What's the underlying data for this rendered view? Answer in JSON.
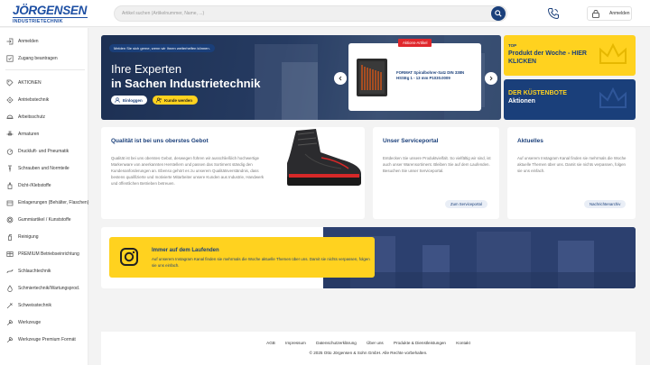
{
  "header": {
    "logo_name": "JÖRGENSEN",
    "logo_sub": "INDUSTRIETECHNIK",
    "search_placeholder": "Artikel suchen (Artikelnummer, Name, ...)",
    "login_label": "Anmelden"
  },
  "sidebar": {
    "items": [
      {
        "label": "Anmelden",
        "icon": "login-icon"
      },
      {
        "label": "Zugang beantragen",
        "icon": "request-access-icon"
      },
      {
        "label": "AKTIONEN",
        "icon": "promotions-icon"
      },
      {
        "label": "Antriebstechnik",
        "icon": "drive-technology-icon"
      },
      {
        "label": "Arbeitsschutz",
        "icon": "safety-icon"
      },
      {
        "label": "Armaturen",
        "icon": "fittings-icon"
      },
      {
        "label": "Druckluft- und Pneumatik",
        "icon": "pneumatics-icon"
      },
      {
        "label": "Schrauben und Normteile",
        "icon": "screws-icon"
      },
      {
        "label": "Dicht-/Klebstoffe",
        "icon": "sealant-icon"
      },
      {
        "label": "Einlagerungen (Behälter, Flaschen)",
        "icon": "storage-icon"
      },
      {
        "label": "Gummiartikel / Kunststoffe",
        "icon": "rubber-icon"
      },
      {
        "label": "Reinigung",
        "icon": "cleaning-icon"
      },
      {
        "label": "PREMIUM Betriebseinrichtung",
        "icon": "premium-icon"
      },
      {
        "label": "Schlauchtechnik",
        "icon": "hose-icon"
      },
      {
        "label": "Schmiertechnik/Wartungsprod.",
        "icon": "lubrication-icon"
      },
      {
        "label": "Schweisstechnik",
        "icon": "welding-icon"
      },
      {
        "label": "Werkzeuge",
        "icon": "tools-icon"
      },
      {
        "label": "Werkzeuge Premium Formát",
        "icon": "premium-tools-icon"
      }
    ]
  },
  "hero": {
    "pill": "Melden Sie sich gerne, wenn wir Ihnen weiterhelfen können.",
    "line1": "Ihre Experten",
    "line2": "in Sachen Industrietechnik",
    "btn_login": "Einloggen",
    "btn_customer": "Kunde werden",
    "product_badge": "Aktions-Artikel",
    "product_title": "FORMAT Spiralbohrer-Satz DIN 338N HSSEg 1 - 13 mm P1030.0009"
  },
  "promos": {
    "top_kicker": "TOP",
    "top_title": "Produkt der Woche - HIER KLICKEN",
    "boat_title": "DER KÜSTENBOTE",
    "boat_sub": "Aktionen"
  },
  "cards": {
    "quality_title": "Qualität ist bei uns oberstes Gebot",
    "quality_text": "Qualität ist bei uns oberstes Gebot, deswegen führen wir ausschließlich hochwertige Markenware von anerkannten Herstellern und passen das Sortiment ständig den Kundenanforderungen an. Ebenso gehört es zu unserem Qualitätsverständnis, dass bestens qualifizierte und motivierte Mitarbeiter unsere Kunden aus Industrie, Handwerk und öffentlichen Betrieben betreuen.",
    "service_title": "Unser Serviceportal",
    "service_text": "Entdecken Sie unsere Produktvielfalt. So vielfältig wir sind, ist auch unser Warensortiment. Bleiben Sie auf dem Laufenden. Besuchen Sie unser Serviceportal.",
    "service_link": "Zum Serviceportal",
    "news_title": "Aktuelles",
    "news_text": "Auf unserem Instagram Kanal finden sie mehrmals die Woche aktuelle Themen über uns. Damit sie nichts verpassen, folgen sie uns einfach.",
    "news_link": "Nachrichtenarchiv"
  },
  "instagram": {
    "title": "Immer auf dem Laufenden",
    "text": "Auf unserem Instagram Kanal finden sie mehrmals die Woche aktuelle Themen über uns. Damit sie nichts verpassen, folgen sie uns einfach."
  },
  "footer": {
    "links": [
      "AGB",
      "Impressum",
      "Datenschutzerklärung",
      "Über uns",
      "Produkte & Dienstleistungen",
      "Kontakt"
    ],
    "copyright": "© 2025 Otto Jörgensen & Sohn GmbH. Alle Rechte vorbehalten."
  },
  "colors": {
    "brand_blue": "#1a3f7a",
    "accent_yellow": "#ffd21f",
    "badge_red": "#e0262b"
  }
}
